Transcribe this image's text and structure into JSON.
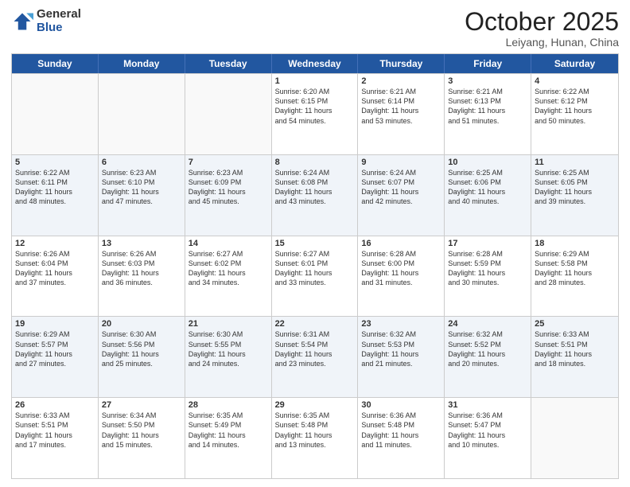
{
  "logo": {
    "general": "General",
    "blue": "Blue"
  },
  "header": {
    "month": "October 2025",
    "location": "Leiyang, Hunan, China"
  },
  "days": [
    "Sunday",
    "Monday",
    "Tuesday",
    "Wednesday",
    "Thursday",
    "Friday",
    "Saturday"
  ],
  "weeks": [
    [
      {
        "day": "",
        "text": ""
      },
      {
        "day": "",
        "text": ""
      },
      {
        "day": "",
        "text": ""
      },
      {
        "day": "1",
        "text": "Sunrise: 6:20 AM\nSunset: 6:15 PM\nDaylight: 11 hours\nand 54 minutes."
      },
      {
        "day": "2",
        "text": "Sunrise: 6:21 AM\nSunset: 6:14 PM\nDaylight: 11 hours\nand 53 minutes."
      },
      {
        "day": "3",
        "text": "Sunrise: 6:21 AM\nSunset: 6:13 PM\nDaylight: 11 hours\nand 51 minutes."
      },
      {
        "day": "4",
        "text": "Sunrise: 6:22 AM\nSunset: 6:12 PM\nDaylight: 11 hours\nand 50 minutes."
      }
    ],
    [
      {
        "day": "5",
        "text": "Sunrise: 6:22 AM\nSunset: 6:11 PM\nDaylight: 11 hours\nand 48 minutes."
      },
      {
        "day": "6",
        "text": "Sunrise: 6:23 AM\nSunset: 6:10 PM\nDaylight: 11 hours\nand 47 minutes."
      },
      {
        "day": "7",
        "text": "Sunrise: 6:23 AM\nSunset: 6:09 PM\nDaylight: 11 hours\nand 45 minutes."
      },
      {
        "day": "8",
        "text": "Sunrise: 6:24 AM\nSunset: 6:08 PM\nDaylight: 11 hours\nand 43 minutes."
      },
      {
        "day": "9",
        "text": "Sunrise: 6:24 AM\nSunset: 6:07 PM\nDaylight: 11 hours\nand 42 minutes."
      },
      {
        "day": "10",
        "text": "Sunrise: 6:25 AM\nSunset: 6:06 PM\nDaylight: 11 hours\nand 40 minutes."
      },
      {
        "day": "11",
        "text": "Sunrise: 6:25 AM\nSunset: 6:05 PM\nDaylight: 11 hours\nand 39 minutes."
      }
    ],
    [
      {
        "day": "12",
        "text": "Sunrise: 6:26 AM\nSunset: 6:04 PM\nDaylight: 11 hours\nand 37 minutes."
      },
      {
        "day": "13",
        "text": "Sunrise: 6:26 AM\nSunset: 6:03 PM\nDaylight: 11 hours\nand 36 minutes."
      },
      {
        "day": "14",
        "text": "Sunrise: 6:27 AM\nSunset: 6:02 PM\nDaylight: 11 hours\nand 34 minutes."
      },
      {
        "day": "15",
        "text": "Sunrise: 6:27 AM\nSunset: 6:01 PM\nDaylight: 11 hours\nand 33 minutes."
      },
      {
        "day": "16",
        "text": "Sunrise: 6:28 AM\nSunset: 6:00 PM\nDaylight: 11 hours\nand 31 minutes."
      },
      {
        "day": "17",
        "text": "Sunrise: 6:28 AM\nSunset: 5:59 PM\nDaylight: 11 hours\nand 30 minutes."
      },
      {
        "day": "18",
        "text": "Sunrise: 6:29 AM\nSunset: 5:58 PM\nDaylight: 11 hours\nand 28 minutes."
      }
    ],
    [
      {
        "day": "19",
        "text": "Sunrise: 6:29 AM\nSunset: 5:57 PM\nDaylight: 11 hours\nand 27 minutes."
      },
      {
        "day": "20",
        "text": "Sunrise: 6:30 AM\nSunset: 5:56 PM\nDaylight: 11 hours\nand 25 minutes."
      },
      {
        "day": "21",
        "text": "Sunrise: 6:30 AM\nSunset: 5:55 PM\nDaylight: 11 hours\nand 24 minutes."
      },
      {
        "day": "22",
        "text": "Sunrise: 6:31 AM\nSunset: 5:54 PM\nDaylight: 11 hours\nand 23 minutes."
      },
      {
        "day": "23",
        "text": "Sunrise: 6:32 AM\nSunset: 5:53 PM\nDaylight: 11 hours\nand 21 minutes."
      },
      {
        "day": "24",
        "text": "Sunrise: 6:32 AM\nSunset: 5:52 PM\nDaylight: 11 hours\nand 20 minutes."
      },
      {
        "day": "25",
        "text": "Sunrise: 6:33 AM\nSunset: 5:51 PM\nDaylight: 11 hours\nand 18 minutes."
      }
    ],
    [
      {
        "day": "26",
        "text": "Sunrise: 6:33 AM\nSunset: 5:51 PM\nDaylight: 11 hours\nand 17 minutes."
      },
      {
        "day": "27",
        "text": "Sunrise: 6:34 AM\nSunset: 5:50 PM\nDaylight: 11 hours\nand 15 minutes."
      },
      {
        "day": "28",
        "text": "Sunrise: 6:35 AM\nSunset: 5:49 PM\nDaylight: 11 hours\nand 14 minutes."
      },
      {
        "day": "29",
        "text": "Sunrise: 6:35 AM\nSunset: 5:48 PM\nDaylight: 11 hours\nand 13 minutes."
      },
      {
        "day": "30",
        "text": "Sunrise: 6:36 AM\nSunset: 5:48 PM\nDaylight: 11 hours\nand 11 minutes."
      },
      {
        "day": "31",
        "text": "Sunrise: 6:36 AM\nSunset: 5:47 PM\nDaylight: 11 hours\nand 10 minutes."
      },
      {
        "day": "",
        "text": ""
      }
    ]
  ]
}
